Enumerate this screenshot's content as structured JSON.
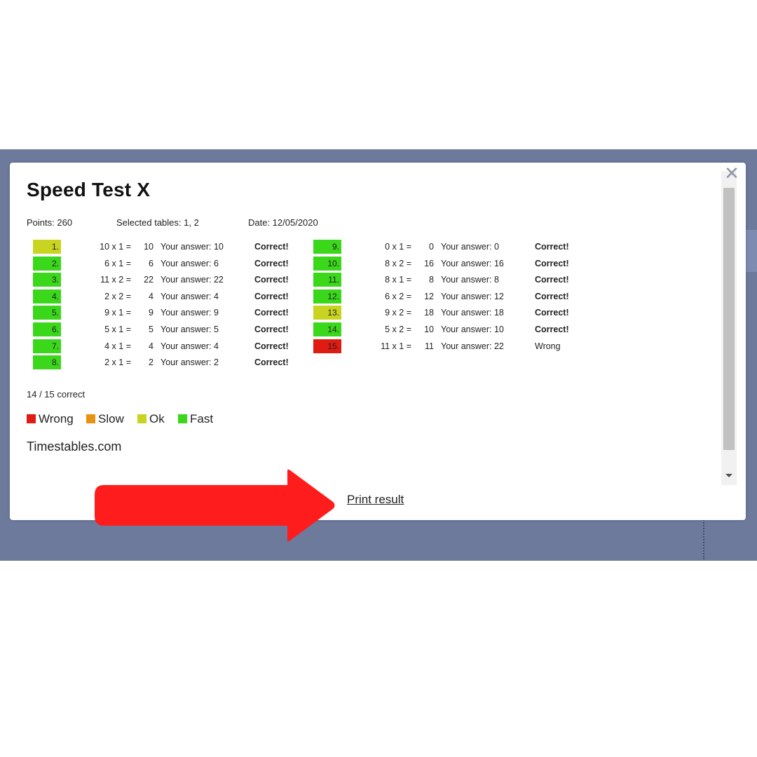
{
  "modal": {
    "title": "Speed Test X",
    "close_icon": "close-icon",
    "points": "Points: 260",
    "selected_tables": "Selected tables: 1, 2",
    "date": "Date: 12/05/2020",
    "summary": "14 / 15 correct",
    "site": "Timestables.com",
    "print_label": "Print result"
  },
  "colors": {
    "wrong": "#e01b12",
    "slow": "#e8920f",
    "ok": "#c9d420",
    "fast": "#3ad71a",
    "arrow": "#ff1c1c"
  },
  "legend": [
    {
      "label": "Wrong",
      "color": "#e01b12"
    },
    {
      "label": "Slow",
      "color": "#e8920f"
    },
    {
      "label": "Ok",
      "color": "#c9d420"
    },
    {
      "label": "Fast",
      "color": "#3ad71a"
    }
  ],
  "results": [
    {
      "num": "1.",
      "question": "10 x 1 =",
      "answer": "10",
      "your": "Your answer: 10",
      "status": "Correct!",
      "speed": "ok"
    },
    {
      "num": "2.",
      "question": "6 x 1 =",
      "answer": "6",
      "your": "Your answer: 6",
      "status": "Correct!",
      "speed": "fast"
    },
    {
      "num": "3.",
      "question": "11 x 2 =",
      "answer": "22",
      "your": "Your answer: 22",
      "status": "Correct!",
      "speed": "fast"
    },
    {
      "num": "4.",
      "question": "2 x 2 =",
      "answer": "4",
      "your": "Your answer: 4",
      "status": "Correct!",
      "speed": "fast"
    },
    {
      "num": "5.",
      "question": "9 x 1 =",
      "answer": "9",
      "your": "Your answer: 9",
      "status": "Correct!",
      "speed": "fast"
    },
    {
      "num": "6.",
      "question": "5 x 1 =",
      "answer": "5",
      "your": "Your answer: 5",
      "status": "Correct!",
      "speed": "fast"
    },
    {
      "num": "7.",
      "question": "4 x 1 =",
      "answer": "4",
      "your": "Your answer: 4",
      "status": "Correct!",
      "speed": "fast"
    },
    {
      "num": "8.",
      "question": "2 x 1 =",
      "answer": "2",
      "your": "Your answer: 2",
      "status": "Correct!",
      "speed": "fast"
    },
    {
      "num": "9.",
      "question": "0 x 1 =",
      "answer": "0",
      "your": "Your answer: 0",
      "status": "Correct!",
      "speed": "fast"
    },
    {
      "num": "10.",
      "question": "8 x 2 =",
      "answer": "16",
      "your": "Your answer: 16",
      "status": "Correct!",
      "speed": "fast"
    },
    {
      "num": "11.",
      "question": "8 x 1 =",
      "answer": "8",
      "your": "Your answer: 8",
      "status": "Correct!",
      "speed": "fast"
    },
    {
      "num": "12.",
      "question": "6 x 2 =",
      "answer": "12",
      "your": "Your answer: 12",
      "status": "Correct!",
      "speed": "fast"
    },
    {
      "num": "13.",
      "question": "9 x 2 =",
      "answer": "18",
      "your": "Your answer: 18",
      "status": "Correct!",
      "speed": "ok"
    },
    {
      "num": "14.",
      "question": "5 x 2 =",
      "answer": "10",
      "your": "Your answer: 10",
      "status": "Correct!",
      "speed": "fast"
    },
    {
      "num": "15.",
      "question": "11 x 1 =",
      "answer": "11",
      "your": "Your answer: 22",
      "status": "Wrong",
      "speed": "wrong"
    }
  ]
}
